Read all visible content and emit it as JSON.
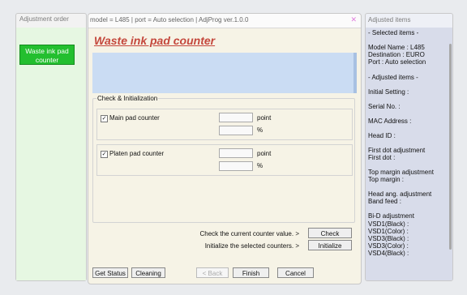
{
  "left_panel": {
    "title": "Adjustment order",
    "items": [
      "Waste ink pad counter"
    ]
  },
  "main_window": {
    "title": "model = L485 | port = Auto selection | AdjProg ver.1.0.0",
    "heading": "Waste ink pad counter",
    "section_title": "Check & Initialization",
    "main_counter_label": "Main pad counter",
    "platen_counter_label": "Platen pad counter",
    "point_unit": "point",
    "percent_unit": "%",
    "check_text": "Check the current counter value.  >",
    "init_text": "Initialize the selected counters.  >",
    "check_button": "Check",
    "initialize_button": "Initialize",
    "bottom_buttons": {
      "get_status": "Get Status",
      "cleaning": "Cleaning",
      "back": "< Back",
      "finish": "Finish",
      "cancel": "Cancel"
    },
    "checkbox_mark": "✓"
  },
  "right_panel": {
    "title": "Adjusted items",
    "lines": [
      "- Selected items -",
      "Model Name : L485",
      "Destination : EURO",
      "Port : Auto selection",
      "- Adjusted items -",
      "Initial Setting :",
      "Serial No. :",
      "MAC Address :",
      "Head ID :",
      "First dot adjustment",
      " First dot :",
      "Top margin adjustment",
      " Top margin :",
      "Head ang. adjustment",
      " Band feed :",
      "Bi-D adjustment",
      " VSD1(Black) :",
      " VSD1(Color) :",
      " VSD3(Black) :",
      " VSD3(Color) :",
      " VSD4(Black) :"
    ]
  },
  "colors": {
    "accent_green": "#23bf2f",
    "heading_red": "#c4473c",
    "blue_panel": "#cadcf3"
  },
  "icons": {
    "close": "close-icon"
  }
}
